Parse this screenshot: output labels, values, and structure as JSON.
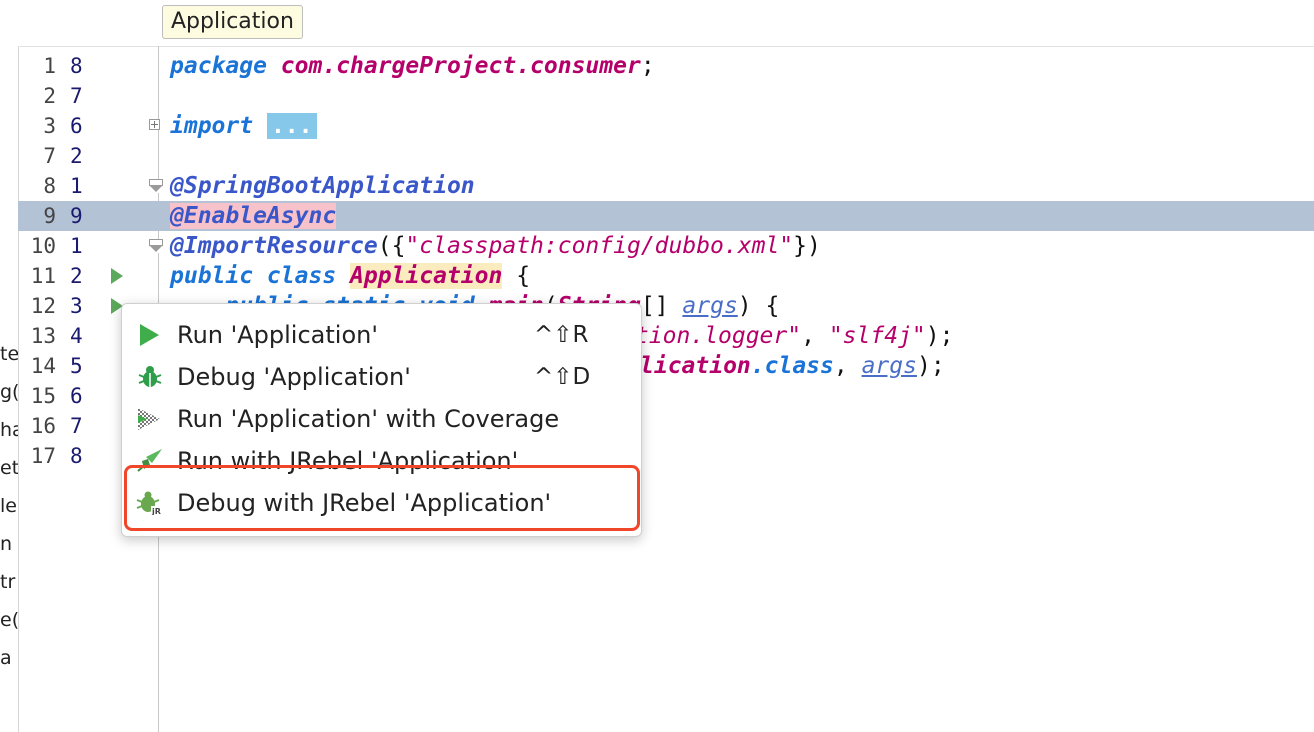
{
  "breadcrumb": {
    "label": "Application"
  },
  "left_fragments": [
    "te",
    "g(",
    "ha",
    "et",
    "le",
    "n",
    "tr",
    "e(",
    "a"
  ],
  "gutter": [
    {
      "ln": "1",
      "rn": "8"
    },
    {
      "ln": "2",
      "rn": "7"
    },
    {
      "ln": "3",
      "rn": "6"
    },
    {
      "ln": "7",
      "rn": "2"
    },
    {
      "ln": "8",
      "rn": "1"
    },
    {
      "ln": "9",
      "rn": "9"
    },
    {
      "ln": "10",
      "rn": "1"
    },
    {
      "ln": "11",
      "rn": "2"
    },
    {
      "ln": "12",
      "rn": "3"
    },
    {
      "ln": "13",
      "rn": "4"
    },
    {
      "ln": "14",
      "rn": "5"
    },
    {
      "ln": "15",
      "rn": "6"
    },
    {
      "ln": "16",
      "rn": "7"
    },
    {
      "ln": "17",
      "rn": "8"
    }
  ],
  "code": {
    "l1_kw": "package",
    "l1_pkg": "com.chargeProject.consumer",
    "l1_semi": ";",
    "l3_kw": "import",
    "l3_ellipsis": "...",
    "l8_ann": "@SpringBootApplication",
    "l9_ann": "@EnableAsync",
    "l10_ann": "@ImportResource",
    "l10_open": "({",
    "l10_str": "\"classpath:config/dubbo.xml\"",
    "l10_close": "})",
    "l11_kw": "public class",
    "l11_cls": "Application",
    "l11_brace": "{",
    "l12_kw": "public static void",
    "l12_m": "main",
    "l12_open": "(",
    "l12_type": "String",
    "l12_arr": "[]",
    "l12_param": "args",
    "l12_close": ") {",
    "l13_str1": "application.logger\"",
    "l13_comma": ", ",
    "l13_str2": "\"slf4j\"",
    "l13_close": ");",
    "l14_cls": "lication",
    "l14_kw": ".class",
    "l14_comma": ", ",
    "l14_param": "args",
    "l14_close": ");"
  },
  "popup": {
    "items": [
      {
        "label": "Run 'Application'",
        "shortcut": "^⇧R",
        "icon": "run-icon"
      },
      {
        "label": "Debug 'Application'",
        "shortcut": "^⇧D",
        "icon": "debug-icon"
      },
      {
        "label": "Run 'Application' with Coverage",
        "shortcut": "",
        "icon": "coverage-icon"
      },
      {
        "label": "Run with JRebel 'Application'",
        "shortcut": "",
        "icon": "jrebel-run-icon"
      },
      {
        "label": "Debug with JRebel 'Application'",
        "shortcut": "",
        "icon": "jrebel-debug-icon"
      }
    ]
  },
  "colors": {
    "highlight_row": "#b4c2d6",
    "annotation_bg": "#f8c2cb",
    "focus_outline": "#f0462a"
  }
}
